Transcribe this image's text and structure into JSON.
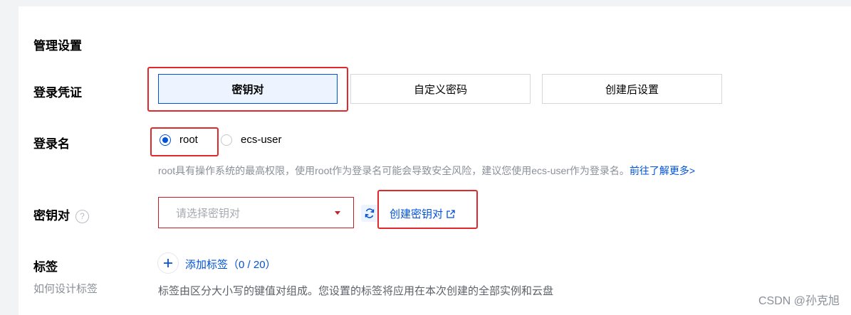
{
  "section": {
    "title": "管理设置"
  },
  "login_credential": {
    "label": "登录凭证",
    "options": [
      "密钥对",
      "自定义密码",
      "创建后设置"
    ],
    "selected_index": 0
  },
  "login_name": {
    "label": "登录名",
    "options": [
      "root",
      "ecs-user"
    ],
    "selected": "root",
    "hint": "root具有操作系统的最高权限，使用root作为登录名可能会导致安全风险，建议您使用ecs-user作为登录名。",
    "hint_link": "前往了解更多>"
  },
  "key_pair": {
    "label": "密钥对",
    "help_glyph": "?",
    "placeholder": "请选择密钥对",
    "create_link": "创建密钥对"
  },
  "tags": {
    "label": "标签",
    "sublabel": "如何设计标签",
    "add_label": "添加标签（0 / 20）",
    "hint": "标签由区分大小写的键值对组成。您设置的标签将应用在本次创建的全部实例和云盘"
  },
  "watermark": "CSDN @孙克旭",
  "colors": {
    "accent": "#0052d9",
    "highlight": "#e0292b",
    "hint_text": "#8a8f99"
  }
}
